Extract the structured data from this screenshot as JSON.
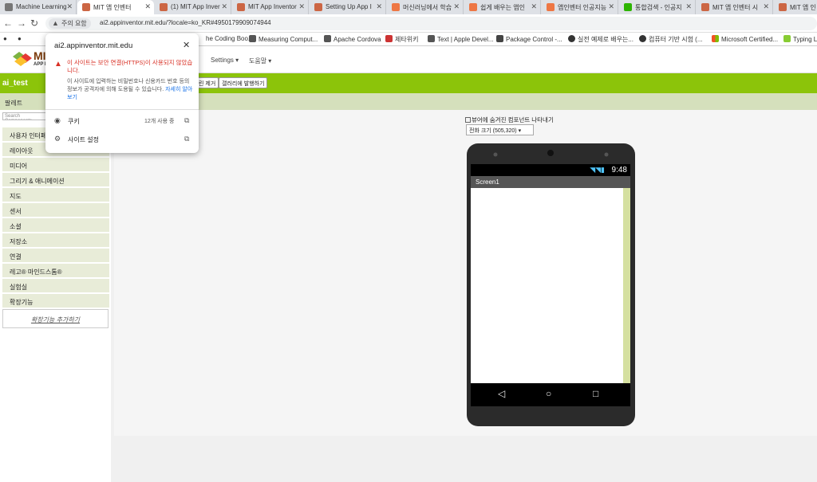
{
  "browser": {
    "tabs": [
      {
        "title": "Machine Learning"
      },
      {
        "title": "MIT 앱 인벤터"
      },
      {
        "title": "(1) MIT App Inver"
      },
      {
        "title": "MIT App Inventor"
      },
      {
        "title": "Setting Up App I"
      },
      {
        "title": "머신러닝에서 학습"
      },
      {
        "title": "쉽게 배우는 앱인"
      },
      {
        "title": "앱인벤터 인공지능"
      },
      {
        "title": "통합검색 - 인공지"
      },
      {
        "title": "MIT 앱 인벤터 시"
      },
      {
        "title": "MIT 앱 인"
      }
    ],
    "security_label": "주의 요함",
    "url": "ai2.appinventor.mit.edu/?locale=ko_KR#4950179909074944",
    "bookmarks": [
      {
        "label": "he Coding Boo..."
      },
      {
        "label": "Measuring Comput..."
      },
      {
        "label": "Apache Cordova"
      },
      {
        "label": "제타위키"
      },
      {
        "label": "Text | Apple Devel..."
      },
      {
        "label": "Package Control -..."
      },
      {
        "label": "실전 예제로 배우는..."
      },
      {
        "label": "컴퓨터 기반 시험 (..."
      },
      {
        "label": "Microsoft Certified..."
      },
      {
        "label": "Typing L"
      }
    ]
  },
  "app": {
    "logo_text": "MI",
    "logo_sub": "APP IN",
    "menus": [
      "Settings ▾",
      "도움말 ▾"
    ],
    "project_name": "ai_test",
    "project_buttons": [
      "린 제거",
      "갤러리에 발행하기"
    ],
    "palette_title": "팔레트",
    "search_placeholder": "Search Components",
    "palette_items": [
      "사용자 인터페이스",
      "레이아웃",
      "미디어",
      "그리기 & 애니메이션",
      "지도",
      "센서",
      "소셜",
      "저장소",
      "연결",
      "레고® 마인드스톰®",
      "실험실",
      "확장기능"
    ],
    "extension_add": "확장기능 추가하기",
    "viewer": {
      "hidden_components_label": "뷰어에 숨겨진 컴포넌트 나타내기",
      "size_select": "전화 크기 (505,320)",
      "clock": "9:48",
      "screen_name": "Screen1"
    }
  },
  "popup": {
    "host": "ai2.appinventor.mit.edu",
    "warning": "이 사이트는 보안 연결(HTTPS)이 사용되지 않았습니다.",
    "description": "이 사이트에 입력하는 비밀번호나 신용카드 번호 등의 정보가 공격자에 의해 도용될 수 있습니다.",
    "learn_more": "자세히 알아보기",
    "cookies_label": "쿠키",
    "cookies_count": "12개 사용 중",
    "site_settings_label": "사이트 설정"
  },
  "colors": {
    "accent_green": "#8cc40a",
    "warning_red": "#d93025",
    "link_blue": "#1a73e8"
  }
}
